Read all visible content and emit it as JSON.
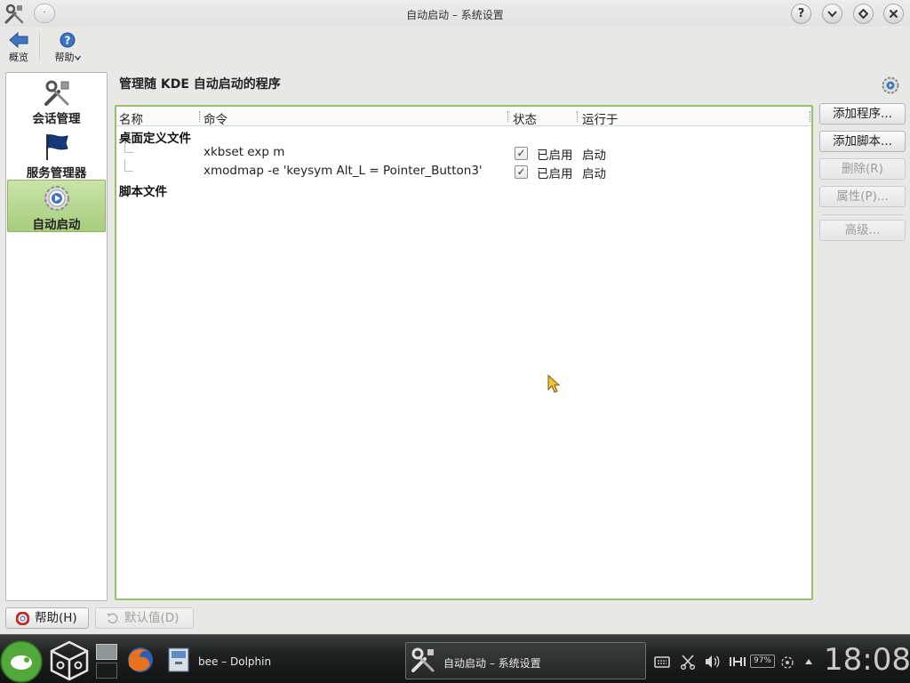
{
  "window": {
    "title": "自动启动 – 系统设置",
    "menu_glyph": "·"
  },
  "toolbar": {
    "overview_label": "概览",
    "help_label": "帮助"
  },
  "sidebar": {
    "items": [
      {
        "label": "会话管理",
        "icon": "tools-icon",
        "active": false
      },
      {
        "label": "服务管理器",
        "icon": "flag-icon",
        "active": false
      },
      {
        "label": "自动启动",
        "icon": "gear-play-icon",
        "active": true
      }
    ]
  },
  "main": {
    "heading": "管理随 KDE 自动启动的程序",
    "columns": [
      "名称",
      "命令",
      "状态",
      "运行于"
    ],
    "groups": [
      {
        "name": "桌面定义文件",
        "rows": [
          {
            "command": "xkbset exp m",
            "checked": true,
            "state": "已启用",
            "run_on": "启动"
          },
          {
            "command": "xmodmap -e 'keysym Alt_L = Pointer_Button3'",
            "checked": true,
            "state": "已启用",
            "run_on": "启动"
          }
        ]
      },
      {
        "name": "脚本文件",
        "rows": []
      }
    ]
  },
  "actions": {
    "add_program": "添加程序...",
    "add_script": "添加脚本...",
    "remove": "删除(R)",
    "properties": "属性(P)...",
    "advanced": "高级..."
  },
  "bottom": {
    "help": "帮助(H)",
    "defaults": "默认值(D)"
  },
  "taskbar": {
    "dolphin_task": "bee – Dolphin",
    "settings_task": "自动启动 – 系统设置",
    "battery": "97%",
    "clock": "18:08"
  },
  "colors": {
    "accent_green": "#98c06b",
    "active_item": "#b4d68c"
  }
}
